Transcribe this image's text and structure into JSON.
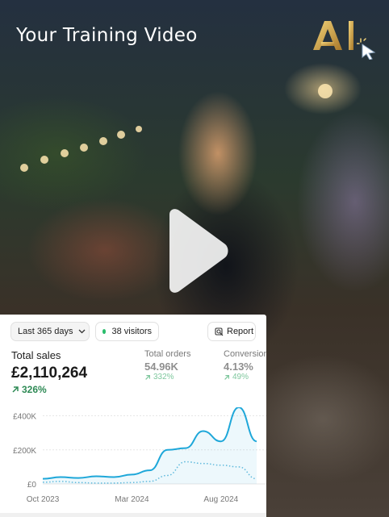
{
  "video": {
    "title": "Your Training Video"
  },
  "logo": {
    "text": "AI",
    "icon": "cursor-click-icon",
    "color": "#c9a24a"
  },
  "play_icon": "play-icon",
  "dashboard": {
    "date_range": "Last 365 days",
    "visitors": "38 visitors",
    "report_label": "Report",
    "total_sales": {
      "label": "Total sales",
      "value": "£2,110,264",
      "delta": "326%"
    },
    "total_orders": {
      "label": "Total orders",
      "value": "54.96K",
      "delta": "332%"
    },
    "conversion": {
      "label": "Conversion",
      "value": "4.13%",
      "delta": "49%"
    },
    "colors": {
      "accent": "#1ea7d9",
      "positive": "#2e8a55",
      "live_dot": "#29bd6c"
    }
  },
  "chart_data": {
    "type": "line",
    "y_ticks": [
      "£400K",
      "£200K",
      "£0"
    ],
    "x_ticks": [
      "Oct 2023",
      "Mar 2024",
      "Aug 2024"
    ],
    "ylim": [
      0,
      450000
    ],
    "grid": true,
    "series": [
      {
        "style": "solid",
        "x": [
          "2023-10",
          "2023-11",
          "2023-12",
          "2024-01",
          "2024-02",
          "2024-03",
          "2024-04",
          "2024-05",
          "2024-06",
          "2024-07",
          "2024-08",
          "2024-09",
          "2024-10"
        ],
        "values": [
          30000,
          40000,
          35000,
          45000,
          40000,
          55000,
          80000,
          200000,
          210000,
          310000,
          250000,
          450000,
          250000
        ]
      },
      {
        "style": "dotted",
        "x": [
          "2023-10",
          "2023-11",
          "2023-12",
          "2024-01",
          "2024-02",
          "2024-03",
          "2024-04",
          "2024-05",
          "2024-06",
          "2024-07",
          "2024-08",
          "2024-09",
          "2024-10"
        ],
        "values": [
          10000,
          15000,
          8000,
          5000,
          5000,
          8000,
          15000,
          50000,
          130000,
          120000,
          110000,
          100000,
          30000
        ]
      }
    ]
  }
}
